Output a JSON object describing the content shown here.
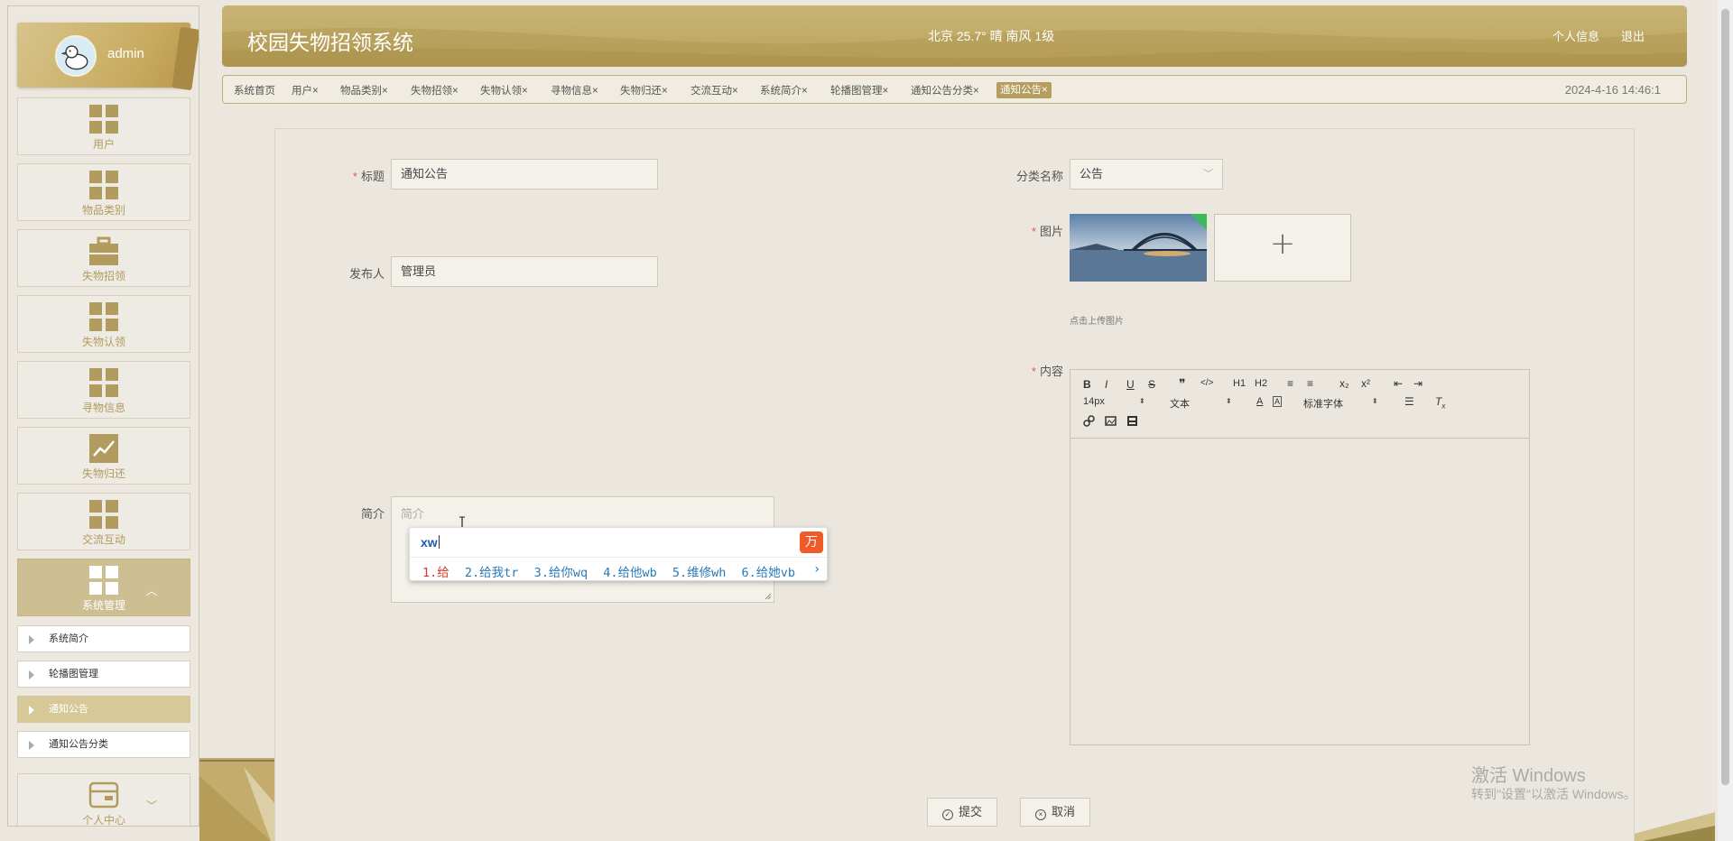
{
  "user": {
    "name": "admin"
  },
  "sidebar": {
    "items": [
      {
        "label": "用户",
        "icon": "grid-icon"
      },
      {
        "label": "物品类别",
        "icon": "grid-icon"
      },
      {
        "label": "失物招领",
        "icon": "briefcase-icon"
      },
      {
        "label": "失物认领",
        "icon": "grid-icon"
      },
      {
        "label": "寻物信息",
        "icon": "grid-icon"
      },
      {
        "label": "失物归还",
        "icon": "chart-icon"
      },
      {
        "label": "交流互动",
        "icon": "grid-icon"
      },
      {
        "label": "系统管理",
        "icon": "grid-icon"
      }
    ],
    "subitems": [
      "系统简介",
      "轮播图管理",
      "通知公告",
      "通知公告分类"
    ],
    "bottom_item": {
      "label": "个人中心",
      "icon": "card-icon"
    }
  },
  "header": {
    "title": "校园失物招领系统",
    "weather": "北京  25.7°  晴  南风  1级",
    "profile_link": "个人信息",
    "logout_link": "退出"
  },
  "tabs": [
    "系统首页",
    "用户",
    "物品类别",
    "失物招领",
    "失物认领",
    "寻物信息",
    "失物归还",
    "交流互动",
    "系统简介",
    "轮播图管理",
    "通知公告分类",
    "通知公告"
  ],
  "tab_close": "×",
  "datetime": "2024-4-16 14:46:1",
  "form": {
    "title_label": "标题",
    "title_value": "通知公告",
    "publisher_label": "发布人",
    "publisher_value": "管理员",
    "intro_label": "简介",
    "intro_placeholder": "简介",
    "category_label": "分类名称",
    "category_value": "公告",
    "image_label": "图片",
    "upload_hint": "点击上传图片",
    "content_label": "内容",
    "submit_label": "提交",
    "cancel_label": "取消"
  },
  "editor": {
    "font_size": "14px",
    "block_type": "文本",
    "font_family": "标准字体",
    "buttons": [
      "B",
      "I",
      "U",
      "S",
      "❞",
      "</>",
      "H1",
      "H2",
      "≡",
      "≡",
      "x₂",
      "x²",
      "⇤",
      "⇥"
    ]
  },
  "ime": {
    "composition": "xw",
    "candidates": [
      "1.给",
      "2.给我tr",
      "3.给你wq",
      "4.给他wb",
      "5.维修wh",
      "6.给她vb"
    ]
  },
  "watermark": {
    "title": "激活 Windows",
    "subtitle": "转到\"设置\"以激活 Windows。"
  },
  "colors": {
    "brand": "#b9a158",
    "accent_active": "#cdbf91",
    "required": "#e15a4a"
  }
}
